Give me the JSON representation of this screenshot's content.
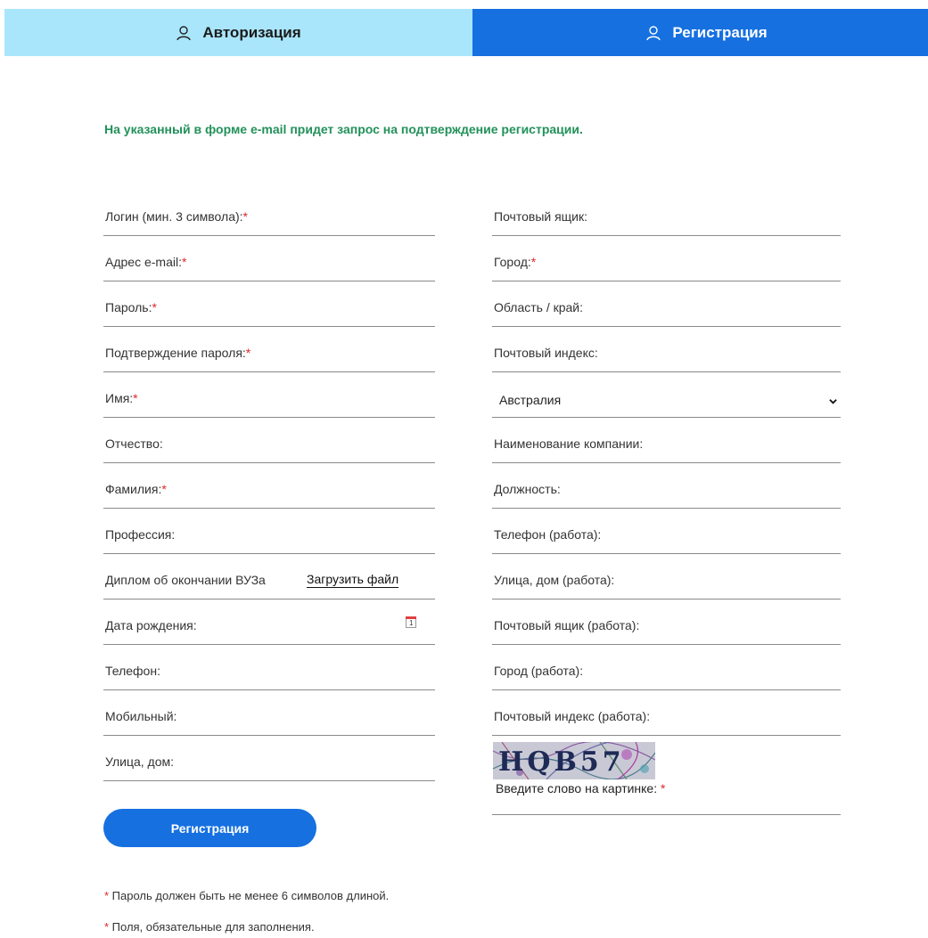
{
  "tabs": {
    "login": "Авторизация",
    "register": "Регистрация"
  },
  "notice": "На указанный в форме e-mail придет запрос на подтверждение регистрации.",
  "left_fields": [
    {
      "label": "Логин (мин. 3 символа):",
      "required": true
    },
    {
      "label": "Адрес e-mail:",
      "required": true
    },
    {
      "label": "Пароль:",
      "required": true
    },
    {
      "label": "Подтверждение пароля:",
      "required": true
    },
    {
      "label": "Имя:",
      "required": true
    },
    {
      "label": "Отчество:",
      "required": false
    },
    {
      "label": "Фамилия:",
      "required": true
    },
    {
      "label": "Профессия:",
      "required": false
    },
    {
      "label": "Диплом об окончании ВУЗа",
      "required": false,
      "upload_label": "Загрузить файл"
    },
    {
      "label": "Дата рождения:",
      "required": false,
      "calendar_day": "1"
    },
    {
      "label": "Телефон:",
      "required": false
    },
    {
      "label": "Мобильный:",
      "required": false
    },
    {
      "label": "Улица, дом:",
      "required": false
    }
  ],
  "right_fields": [
    {
      "label": "Почтовый ящик:",
      "required": false
    },
    {
      "label": "Город:",
      "required": true
    },
    {
      "label": "Область / край:",
      "required": false
    },
    {
      "label": "Почтовый индекс:",
      "required": false
    },
    {
      "label": "Австралия",
      "select": true
    },
    {
      "label": "Наименование компании:",
      "required": false
    },
    {
      "label": "Должность:",
      "required": false
    },
    {
      "label": "Телефон (работа):",
      "required": false
    },
    {
      "label": "Улица, дом (работа):",
      "required": false
    },
    {
      "label": "Почтовый ящик (работа):",
      "required": false
    },
    {
      "label": "Город (работа):",
      "required": false
    },
    {
      "label": "Почтовый индекс (работа):",
      "required": false
    }
  ],
  "captcha": {
    "text": "HQB57",
    "label": "Введите слово на картинке: ",
    "required_mark": "*"
  },
  "submit_label": "Регистрация",
  "notes": [
    {
      "mark": "*",
      "text": " Пароль должен быть не менее 6 символов длиной."
    },
    {
      "mark": "*",
      "text": " Поля, обязательные для заполнения."
    }
  ],
  "colors": {
    "tab_active": "#1670e0",
    "tab_inactive": "#a9e6fb",
    "notice": "#22915a",
    "required": "#e0262a"
  }
}
